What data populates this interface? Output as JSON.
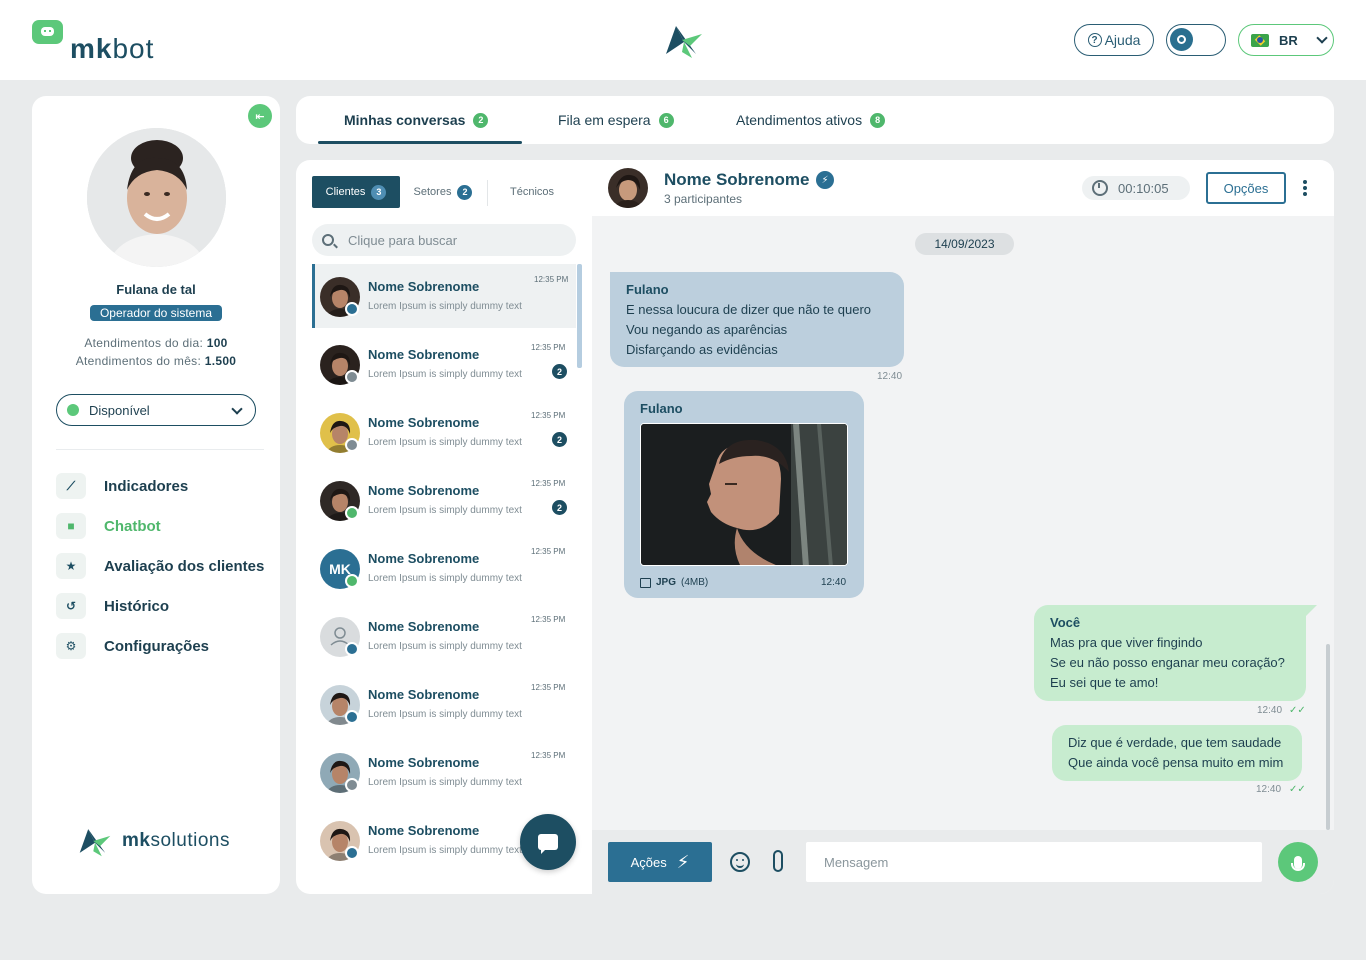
{
  "header": {
    "logo_brand_bold": "mk",
    "logo_brand_thin": "bot",
    "help_label": "Ajuda",
    "language": "BR"
  },
  "profile": {
    "name": "Fulana de tal",
    "role": "Operador do sistema",
    "daily_label": "Atendimentos do dia:",
    "daily_value": "100",
    "monthly_label": "Atendimentos do mês:",
    "monthly_value": "1.500",
    "status": "Disponível"
  },
  "nav": {
    "items": [
      {
        "label": "Indicadores",
        "icon": "chart-icon"
      },
      {
        "label": "Chatbot",
        "icon": "chat-icon"
      },
      {
        "label": "Avaliação dos clientes",
        "icon": "star-icon"
      },
      {
        "label": "Histórico",
        "icon": "history-icon"
      },
      {
        "label": "Configurações",
        "icon": "gear-icon"
      }
    ]
  },
  "footer_logo": {
    "bold": "mk",
    "thin": "solutions"
  },
  "tabs": [
    {
      "label": "Minhas conversas",
      "count": "2"
    },
    {
      "label": "Fila em espera",
      "count": "6"
    },
    {
      "label": "Atendimentos ativos",
      "count": "8"
    }
  ],
  "subtabs": [
    {
      "label": "Clientes",
      "count": "3"
    },
    {
      "label": "Setores",
      "count": "2"
    },
    {
      "label": "Técnicos"
    }
  ],
  "search": {
    "placeholder": "Clique para buscar"
  },
  "conversations": [
    {
      "name": "Nome Sobrenome",
      "preview": "Lorem Ipsum is simply dummy text",
      "time": "12:35 PM",
      "badge": "",
      "channel": "messenger"
    },
    {
      "name": "Nome Sobrenome",
      "preview": "Lorem Ipsum is simply dummy text",
      "time": "12:35 PM",
      "badge": "2",
      "channel": "instagram"
    },
    {
      "name": "Nome Sobrenome",
      "preview": "Lorem Ipsum is simply dummy text",
      "time": "12:35 PM",
      "badge": "2",
      "channel": "instagram"
    },
    {
      "name": "Nome Sobrenome",
      "preview": "Lorem Ipsum is simply dummy text",
      "time": "12:35 PM",
      "badge": "2",
      "channel": "whatsapp"
    },
    {
      "name": "Nome Sobrenome",
      "preview": "Lorem Ipsum is simply dummy text",
      "time": "12:35 PM",
      "badge": "",
      "channel": "whatsapp",
      "initials": "MK"
    },
    {
      "name": "Nome Sobrenome",
      "preview": "Lorem Ipsum is simply dummy text",
      "time": "12:35 PM",
      "badge": "",
      "channel": "messenger"
    },
    {
      "name": "Nome Sobrenome",
      "preview": "Lorem Ipsum is simply dummy text",
      "time": "12:35 PM",
      "badge": "",
      "channel": "messenger"
    },
    {
      "name": "Nome Sobrenome",
      "preview": "Lorem Ipsum is simply dummy text",
      "time": "12:35 PM",
      "badge": "",
      "channel": "instagram"
    },
    {
      "name": "Nome Sobrenome",
      "preview": "Lorem Ipsum is simply dummy text",
      "time": "",
      "badge": "",
      "channel": "messenger"
    }
  ],
  "chat": {
    "name": "Nome Sobrenome",
    "participants": "3 participantes",
    "timer": "00:10:05",
    "options_label": "Opções",
    "date": "14/09/2023",
    "messages": [
      {
        "sender": "Fulano",
        "lines": [
          "E nessa loucura de dizer que não te quero",
          "Vou negando as aparências",
          "Disfarçando as evidências"
        ],
        "time": "12:40"
      },
      {
        "sender": "Fulano",
        "file_type": "JPG",
        "file_size": "(4MB)",
        "time": "12:40"
      },
      {
        "sender": "Você",
        "lines": [
          "Mas pra que viver fingindo",
          "Se eu não posso enganar meu coração?",
          "Eu sei que te amo!"
        ],
        "time": "12:40"
      },
      {
        "lines": [
          "Diz que é verdade, que tem saudade",
          "Que ainda você pensa muito em mim"
        ],
        "time": "12:40"
      }
    ],
    "actions_label": "Ações",
    "input_placeholder": "Mensagem"
  },
  "colors": {
    "brand_dark": "#1d4e62",
    "brand_green": "#5cc87a",
    "brand_blue": "#2b6f93",
    "bubble_in": "#bccfdd",
    "bubble_out": "#c7eccf"
  }
}
